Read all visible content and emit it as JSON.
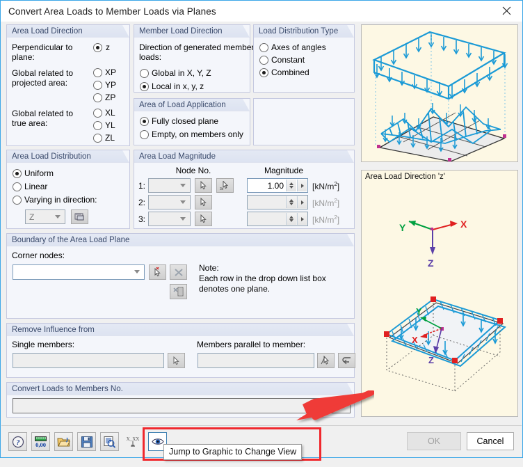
{
  "window": {
    "title": "Convert Area Loads to Member Loads via Planes",
    "close_icon": "close-icon"
  },
  "area_load_direction": {
    "header": "Area Load Direction",
    "labels": {
      "perpendicular": "Perpendicular to\nplane:",
      "projected": "Global related to\nprojected area:",
      "true_area": "Global related to\ntrue area:"
    },
    "options": [
      {
        "id": "z",
        "label": "z",
        "selected": true
      },
      {
        "id": "xp",
        "label": "XP",
        "selected": false
      },
      {
        "id": "yp",
        "label": "YP",
        "selected": false
      },
      {
        "id": "zp",
        "label": "ZP",
        "selected": false
      },
      {
        "id": "xl",
        "label": "XL",
        "selected": false
      },
      {
        "id": "yl",
        "label": "YL",
        "selected": false
      },
      {
        "id": "zl",
        "label": "ZL",
        "selected": false
      }
    ]
  },
  "area_load_distribution": {
    "header": "Area Load Distribution",
    "options": [
      {
        "label": "Uniform",
        "selected": true
      },
      {
        "label": "Linear",
        "selected": false
      },
      {
        "label": "Varying in direction:",
        "selected": false
      }
    ],
    "direction_combo": {
      "value": "Z",
      "enabled": false
    },
    "direction_button_icon": "pick-direction-icon"
  },
  "member_load_direction": {
    "header": "Member Load Direction",
    "caption": "Direction of generated member\nloads:",
    "options": [
      {
        "label": "Global in X, Y, Z",
        "selected": false
      },
      {
        "label": "Local in x, y, z",
        "selected": true
      }
    ]
  },
  "area_of_load_application": {
    "header": "Area of Load Application",
    "options": [
      {
        "label": "Fully closed plane",
        "selected": true
      },
      {
        "label": "Empty, on members only",
        "selected": false
      }
    ]
  },
  "load_distribution_type": {
    "header": "Load Distribution Type",
    "options": [
      {
        "label": "Axes of angles",
        "selected": false
      },
      {
        "label": "Constant",
        "selected": false
      },
      {
        "label": "Combined",
        "selected": true
      }
    ]
  },
  "area_load_magnitude": {
    "header": "Area Load Magnitude",
    "col_node": "Node No.",
    "col_magnitude": "Magnitude",
    "rows": [
      {
        "index": "1:",
        "node_value": "",
        "magnitude": "1.00",
        "unit": "[kN/m2]",
        "enabled": true,
        "pick_icon": "pick-node-icon",
        "pick3_icon": "pick-3-nodes-icon"
      },
      {
        "index": "2:",
        "node_value": "",
        "magnitude": "",
        "unit": "[kN/m2]",
        "enabled": false,
        "pick_icon": "pick-node-icon"
      },
      {
        "index": "3:",
        "node_value": "",
        "magnitude": "",
        "unit": "[kN/m2]",
        "enabled": false,
        "pick_icon": "pick-node-icon"
      }
    ]
  },
  "boundary": {
    "header": "Boundary of the Area Load Plane",
    "corner_nodes_label": "Corner nodes:",
    "corner_nodes_value": "",
    "pick_icon": "pick-nodes-icon",
    "delete_icon": "delete-row-icon",
    "list_icon": "edit-list-icon",
    "note_title": "Note:",
    "note_line1": "Each row in the drop down list box",
    "note_line2": "denotes one plane."
  },
  "remove_influence": {
    "header": "Remove Influence from",
    "single_members_label": "Single members:",
    "single_members_value": "",
    "single_pick_icon": "pick-members-icon",
    "parallel_label": "Members parallel to member:",
    "parallel_value": "",
    "parallel_pick_icon": "pick-parallel-members-icon",
    "parallel_extra_icon": "select-members-icon"
  },
  "convert_loads": {
    "header": "Convert Loads to Members No.",
    "value": ""
  },
  "graphics": {
    "top_panel_alt": "isometric-frame-load-conversion-diagram",
    "bottom_panel_caption": "Area Load Direction 'z'",
    "axes": {
      "x": "X",
      "y": "Y",
      "z": "Z"
    },
    "bottom_panel_alt": "inclined-plane-area-load-diagram",
    "colors": {
      "member": "#1a9ad6",
      "axis_x": "#e02020",
      "axis_y": "#00a040",
      "axis_z": "#5b3fa8",
      "node": "#e02020"
    }
  },
  "toolbar": {
    "buttons": [
      {
        "icon": "help-icon",
        "name": "help-button"
      },
      {
        "icon": "units-icon",
        "name": "units-button"
      },
      {
        "icon": "open-icon",
        "name": "load-defaults-button"
      },
      {
        "icon": "save-icon",
        "name": "save-defaults-button"
      },
      {
        "icon": "details-icon",
        "name": "details-button"
      },
      {
        "icon": "set-value-icon",
        "name": "set-value-button"
      },
      {
        "icon": "eye-icon",
        "name": "jump-to-graphic-button"
      }
    ],
    "tooltip": "Jump to Graphic to Change View"
  },
  "dialog_buttons": {
    "ok": {
      "label": "OK",
      "enabled": false
    },
    "cancel": {
      "label": "Cancel",
      "enabled": true
    }
  },
  "annotations": {
    "highlight_color": "#f0282d",
    "arrow_color": "#ef3b37"
  }
}
